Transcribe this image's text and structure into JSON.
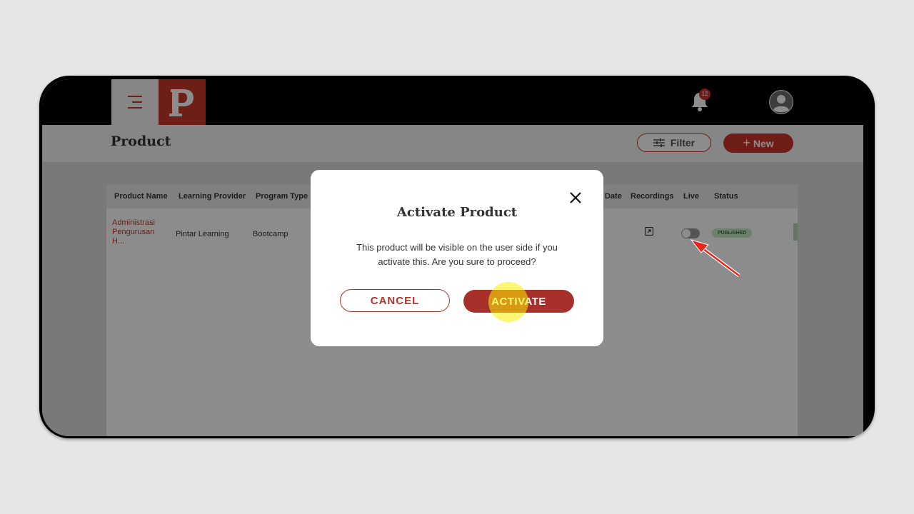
{
  "header": {
    "notification_count": "12"
  },
  "page": {
    "title": "Product",
    "filter_label": "Filter",
    "new_label": "New"
  },
  "table": {
    "columns": [
      "Product Name",
      "Learning Provider",
      "Program Type",
      "Date",
      "Recordings",
      "Live",
      "Status"
    ],
    "rows": [
      {
        "product_name": "Administrasi Pengurusan H...",
        "learning_provider": "Pintar Learning",
        "program_type": "Bootcamp",
        "live": false,
        "status": "PUBLISHED"
      }
    ]
  },
  "modal": {
    "title": "Activate Product",
    "body": "This product will be visible on the user side if you activate this. Are you sure to proceed?",
    "cancel_label": "CANCEL",
    "activate_label": "ACTIVATE"
  },
  "colors": {
    "brand": "#c8352a",
    "activate_button": "#a8302a",
    "status_published_bg": "#c9e8c9",
    "status_published_text": "#2e7d32"
  }
}
